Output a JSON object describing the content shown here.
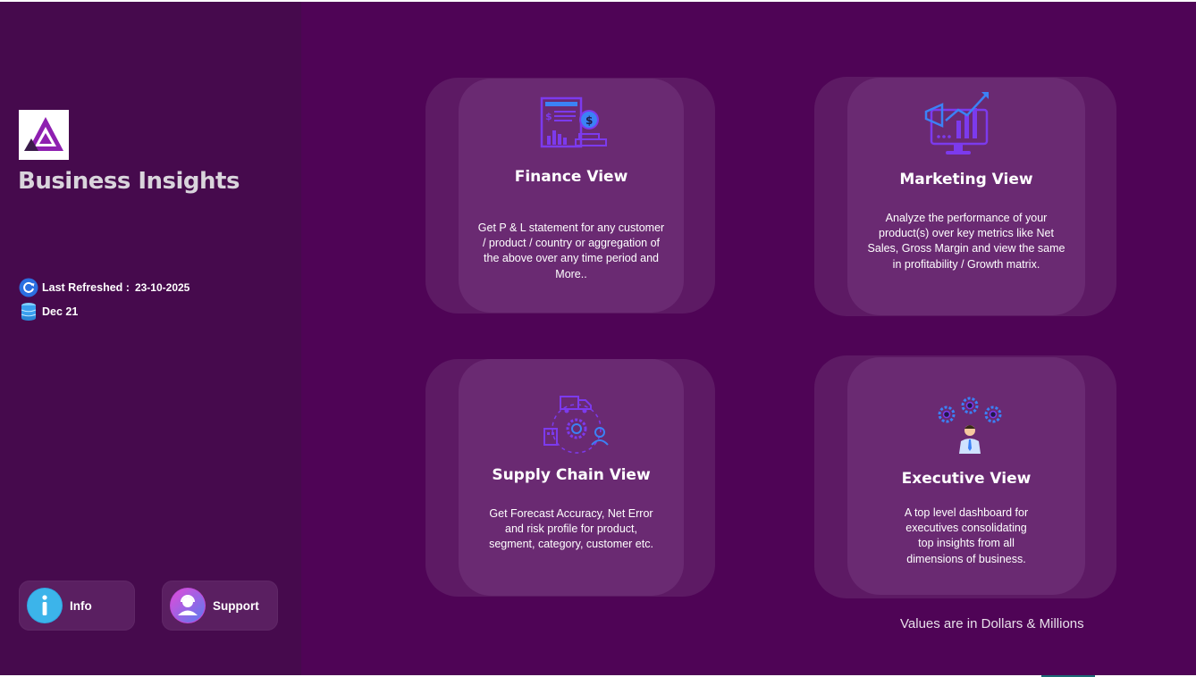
{
  "app": {
    "title": "Business Insights"
  },
  "meta": {
    "refresh_label": "Last Refreshed :",
    "refresh_date": "23-10-2025",
    "data_period": "Dec 21"
  },
  "buttons": {
    "info": "Info",
    "support": "Support"
  },
  "cards": [
    {
      "title": "Finance View",
      "description": "Get  P & L statement for any customer\n/ product / country or aggregation of\nthe above over any time period and\nMore..",
      "icon": "finance-report-icon"
    },
    {
      "title": "Marketing View",
      "description": "Analyze the performance of your\nproduct(s) over key metrics like Net\nSales, Gross Margin and view the same\nin profitability / Growth matrix.",
      "icon": "marketing-growth-icon"
    },
    {
      "title": "Supply Chain View",
      "description": "Get Forecast Accuracy, Net Error\nand risk profile for product,\nsegment, category, customer etc.",
      "icon": "supply-chain-icon"
    },
    {
      "title": "Executive View",
      "description": "A top level dashboard for\nexecutives consolidating\ntop insights from all\ndimensions of business.",
      "icon": "executive-gears-icon"
    }
  ],
  "footnote": "Values are in Dollars & Millions",
  "colors": {
    "background": "#4f0456",
    "sidebar": "#460a4d",
    "card": "#6a2a72",
    "accent": "#7c3aed"
  }
}
